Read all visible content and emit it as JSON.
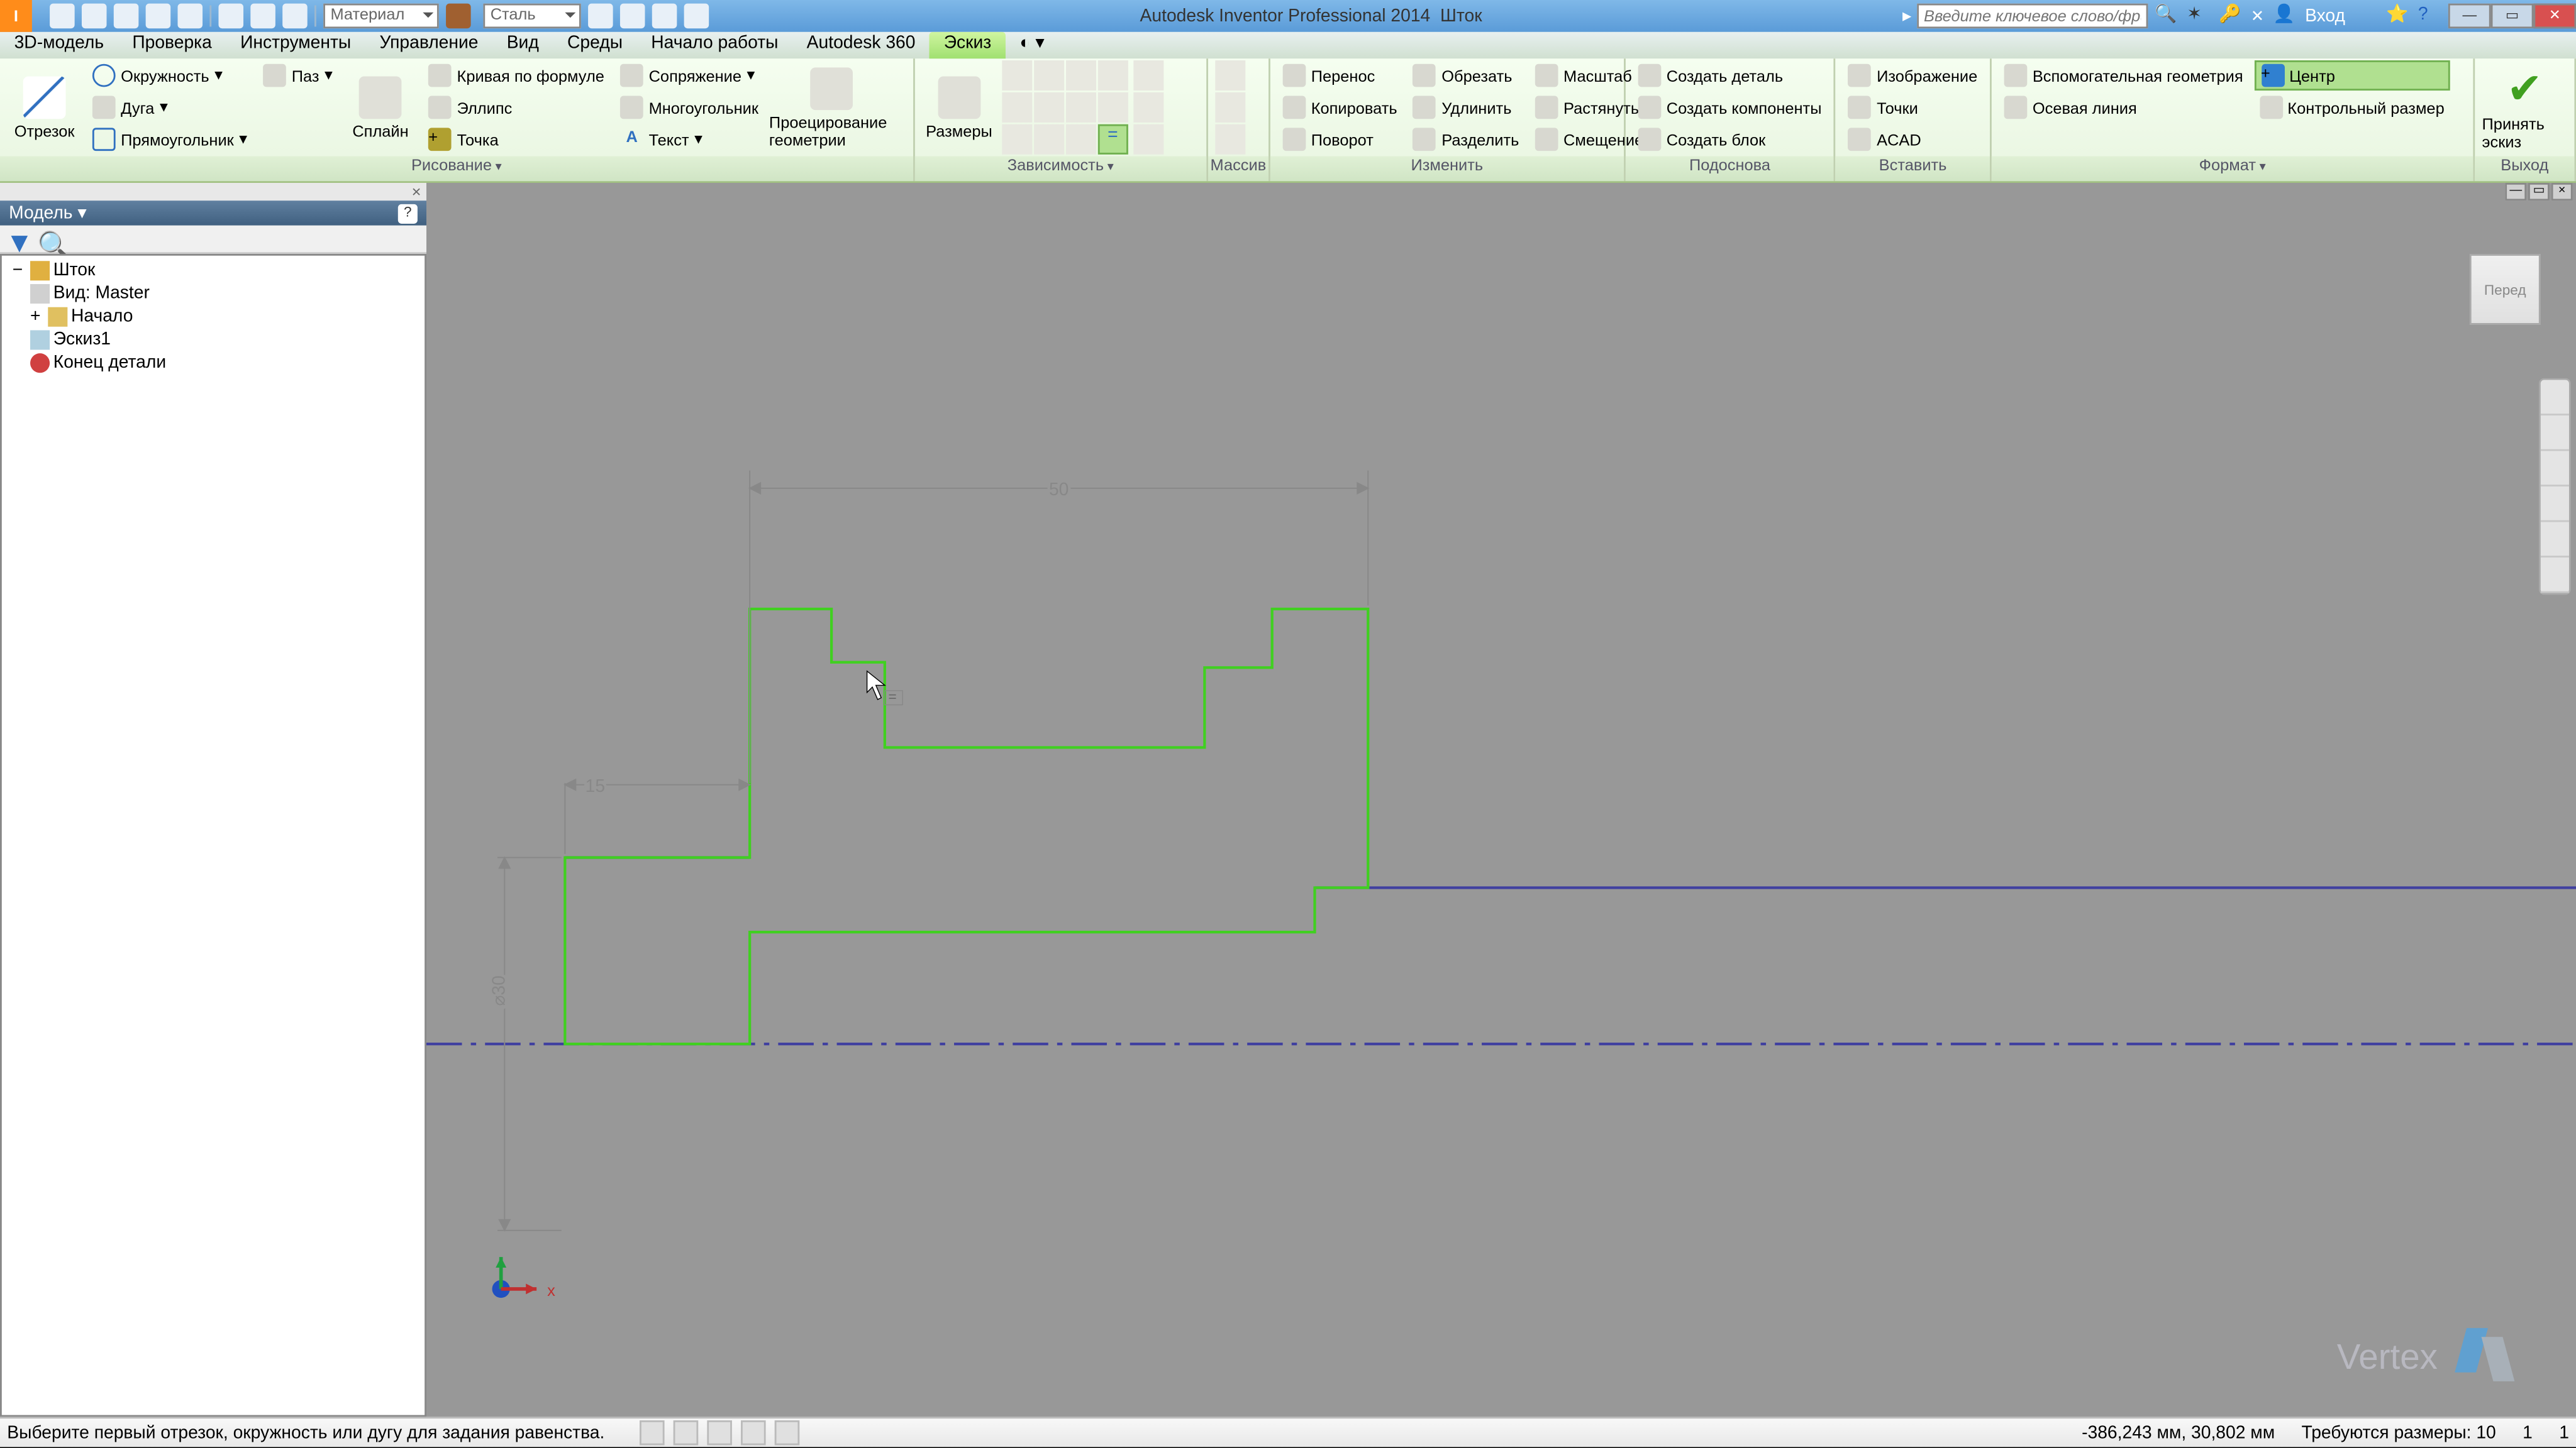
{
  "app": {
    "title_main": "Autodesk Inventor Professional 2014",
    "title_doc": "Шток",
    "search_placeholder": "Введите ключевое слово/фразу",
    "signin": "Вход",
    "material_dropdown": "Материал",
    "material2_dropdown": "Сталь"
  },
  "menutabs": {
    "t1": "3D-модель",
    "t2": "Проверка",
    "t3": "Инструменты",
    "t4": "Управление",
    "t5": "Вид",
    "t6": "Среды",
    "t7": "Начало работы",
    "t8": "Autodesk 360",
    "t9": "Эскиз"
  },
  "ribbon": {
    "draw": {
      "title": "Рисование",
      "line": "Отрезок",
      "circle": "Окружность",
      "arc": "Дуга",
      "rect": "Прямоугольник",
      "slot": "Паз",
      "spline": "Сплайн",
      "eqcurve": "Кривая по формуле",
      "ellipse": "Эллипс",
      "point": "Точка",
      "fillet": "Сопряжение",
      "polygon": "Многоугольник",
      "text": "Текст",
      "project": "Проецирование геометрии"
    },
    "dim": {
      "title_constr": "Зависимость",
      "title_mass": "Массив",
      "dimension": "Размеры"
    },
    "modify": {
      "title": "Изменить",
      "move": "Перенос",
      "copy": "Копировать",
      "rotate": "Поворот",
      "trim": "Обрезать",
      "extend": "Удлинить",
      "split": "Разделить",
      "scale": "Масштаб",
      "stretch": "Растянуть",
      "offset": "Смещение"
    },
    "layout": {
      "title": "Подоснова",
      "makepart": "Создать деталь",
      "makecomp": "Создать компоненты",
      "makeblk": "Создать блок"
    },
    "insert": {
      "title": "Вставить",
      "image": "Изображение",
      "points": "Точки",
      "acad": "ACAD"
    },
    "format": {
      "title": "Формат",
      "constr": "Вспомогательная геометрия",
      "centerline": "Осевая линия",
      "centerpt": "Центр",
      "drivendim": "Контрольный размер"
    },
    "exit": {
      "title": "Выход",
      "finish": "Принять эскиз"
    }
  },
  "browser": {
    "header": "Модель",
    "items": {
      "root": "Шток",
      "view": "Вид: Master",
      "origin": "Начало",
      "sketch": "Эскиз1",
      "eop": "Конец детали"
    }
  },
  "canvas": {
    "dim50": "50",
    "dim15": "15",
    "dim30": "⌀30",
    "viewface": "Перед",
    "axis_x": "x"
  },
  "watermark": {
    "text": "Vertex"
  },
  "statusbar": {
    "hint": "Выберите первый отрезок, окружность или дугу для задания равенства.",
    "coords": "-386,243 мм, 30,802 мм",
    "dims_needed": "Требуются размеры: 10",
    "one_a": "1",
    "one_b": "1"
  }
}
